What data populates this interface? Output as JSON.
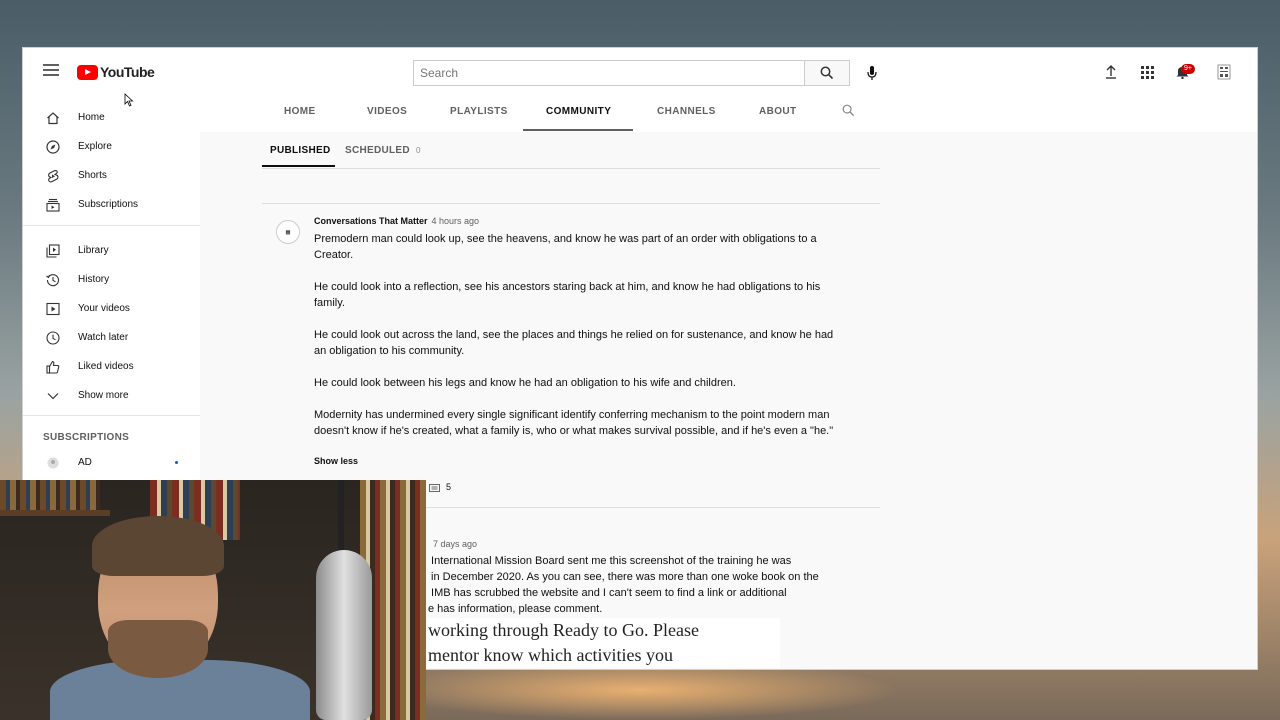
{
  "app": {
    "logo_text": "YouTube",
    "notification_badge": "9+"
  },
  "search": {
    "placeholder": "Search"
  },
  "icons": {
    "menu": "hamburger-menu-icon",
    "search": "magnifier-icon",
    "mic": "microphone-icon",
    "upload": "upload-arrow-icon",
    "apps": "grid-apps-icon",
    "notifications": "bell-icon",
    "avatar": "account-avatar-icon"
  },
  "sidebar": {
    "items": [
      {
        "label": "Home",
        "icon": "home-icon"
      },
      {
        "label": "Explore",
        "icon": "compass-icon"
      },
      {
        "label": "Shorts",
        "icon": "shorts-icon"
      },
      {
        "label": "Subscriptions",
        "icon": "subscriptions-icon"
      },
      {
        "label": "Library",
        "icon": "library-icon"
      },
      {
        "label": "History",
        "icon": "history-icon"
      },
      {
        "label": "Your videos",
        "icon": "play-box-icon"
      },
      {
        "label": "Watch later",
        "icon": "clock-icon"
      },
      {
        "label": "Liked videos",
        "icon": "thumbs-up-icon"
      },
      {
        "label": "Show more",
        "icon": "chevron-down-icon"
      }
    ],
    "subscriptions_heading": "SUBSCRIPTIONS",
    "subscriptions": [
      {
        "label": "AD"
      }
    ]
  },
  "channel_tabs": [
    "HOME",
    "VIDEOS",
    "PLAYLISTS",
    "COMMUNITY",
    "CHANNELS",
    "ABOUT"
  ],
  "active_tab": "COMMUNITY",
  "community": {
    "subtabs": {
      "published": "PUBLISHED",
      "scheduled": "SCHEDULED",
      "scheduled_count": "0"
    },
    "post1": {
      "avatar_text": "▦",
      "author": "Conversations That Matter",
      "time": "4 hours ago",
      "paragraphs": [
        "Premodern man could look up, see the heavens, and know he was part of an order with obligations to a Creator.",
        "He could look into a reflection, see his ancestors staring back at him, and know he had obligations to his family.",
        "He could look out across the land, see the places and things he relied on for sustenance, and know he had an obligation to his community.",
        "He could look between his legs and know he had an obligation to his wife and children.",
        "Modernity has undermined every single significant identify conferring mechanism to the point modern man doesn't know if he's created, what a family is, who or what makes survival possible, and if he's even a \"he.\""
      ],
      "show_less": "Show less",
      "comment_count": "5"
    },
    "post2": {
      "time": "7 days ago",
      "body": " International Mission Board sent me this screenshot of the training he was\n in December 2020. As you can see, there was more than one woke book on the\n IMB has scrubbed the website and I can't seem to find a link or additional\ne has information, please comment.",
      "image_text": "working through Ready to Go. Please\nmentor know which activities you"
    }
  }
}
